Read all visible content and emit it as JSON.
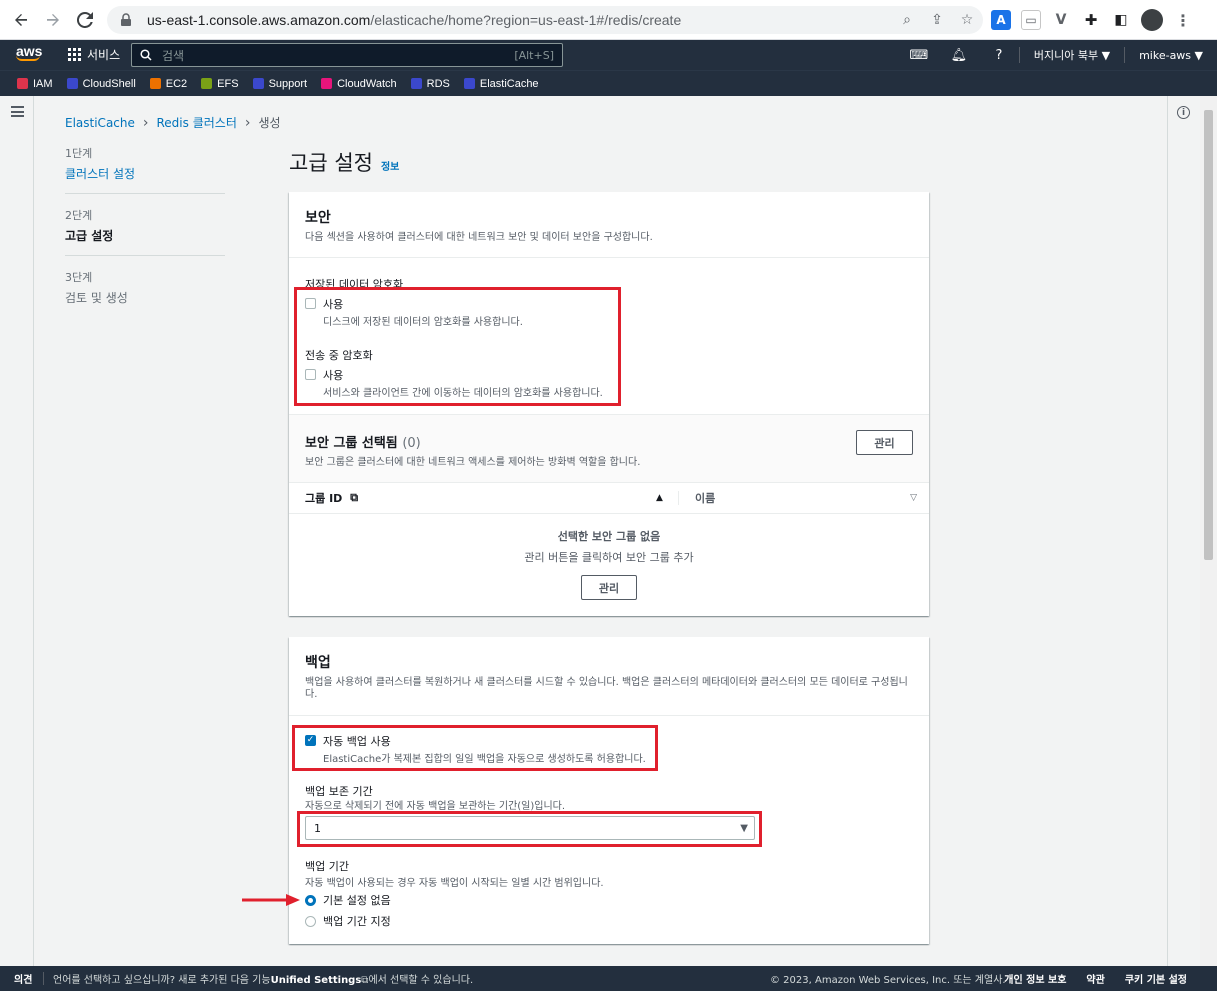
{
  "browser": {
    "url_domain": "us-east-1.console.aws.amazon.com",
    "url_path": "/elasticache/home?region=us-east-1#/redis/create"
  },
  "aws_nav": {
    "logo": "aws",
    "services": "서비스",
    "search_placeholder": "검색",
    "search_shortcut": "[Alt+S]",
    "region": "버지니아 북부 ▼",
    "account": "mike-aws ▼"
  },
  "favorites": [
    {
      "label": "IAM",
      "color": "#dd344c"
    },
    {
      "label": "CloudShell",
      "color": "#3b48cc"
    },
    {
      "label": "EC2",
      "color": "#ed7100"
    },
    {
      "label": "EFS",
      "color": "#7aa116"
    },
    {
      "label": "Support",
      "color": "#3b48cc"
    },
    {
      "label": "CloudWatch",
      "color": "#e7157b"
    },
    {
      "label": "RDS",
      "color": "#3b48cc"
    },
    {
      "label": "ElastiCache",
      "color": "#3b48cc"
    }
  ],
  "breadcrumb": {
    "item1": "ElastiCache",
    "item2": "Redis 클러스터",
    "current": "생성"
  },
  "steps": [
    {
      "num": "1단계",
      "label": "클러스터 설정"
    },
    {
      "num": "2단계",
      "label": "고급 설정"
    },
    {
      "num": "3단계",
      "label": "검토 및 생성"
    }
  ],
  "page": {
    "title": "고급 설정",
    "info": "정보"
  },
  "security": {
    "title": "보안",
    "desc": "다음 섹션을 사용하여 클러스터에 대한 네트워크 보안 및 데이터 보안을 구성합니다.",
    "at_rest_title": "저장된 데이터 암호화",
    "at_rest_label": "사용",
    "at_rest_desc": "디스크에 저장된 데이터의 암호화를 사용합니다.",
    "in_transit_title": "전송 중 암호화",
    "in_transit_label": "사용",
    "in_transit_desc": "서비스와 클라이언트 간에 이동하는 데이터의 암호화를 사용합니다.",
    "sg_title": "보안 그룹 선택됨",
    "sg_count": "(0)",
    "sg_desc": "보안 그룹은 클러스터에 대한 네트워크 액세스를 제어하는 방화벽 역할을 합니다.",
    "manage_label": "관리",
    "col_group_id": "그룹 ID",
    "col_name": "이름",
    "empty_title": "선택한 보안 그룹 없음",
    "empty_desc": "관리 버튼을 클릭하여 보안 그룹 추가",
    "empty_manage": "관리"
  },
  "backup": {
    "title": "백업",
    "desc": "백업을 사용하여 클러스터를 복원하거나 새 클러스터를 시드할 수 있습니다. 백업은 클러스터의 메타데이터와 클러스터의 모든 데이터로 구성됩니다.",
    "auto_label": "자동 백업 사용",
    "auto_desc": "ElastiCache가 복제본 집합의 일일 백업을 자동으로 생성하도록 허용합니다.",
    "auto_checked": true,
    "retention_title": "백업 보존 기간",
    "retention_desc": "자동으로 삭제되기 전에 자동 백업을 보관하는 기간(일)입니다.",
    "retention_value": "1",
    "window_title": "백업 기간",
    "window_desc": "자동 백업이 사용되는 경우 자동 백업이 시작되는 일별 시간 범위입니다.",
    "option_none": "기본 설정 없음",
    "option_specify": "백업 기간 지정"
  },
  "footer": {
    "feedback": "의견",
    "lang_text": "언어를 선택하고 싶으십니까? 새로 추가된 다음 기능",
    "lang_link": "Unified Settings",
    "lang_text2": "에서 선택할 수 있습니다.",
    "copyright": "© 2023, Amazon Web Services, Inc. 또는 계열사.",
    "privacy": "개인 정보 보호",
    "terms": "약관",
    "cookies": "쿠키 기본 설정"
  },
  "colors": {
    "aws_dark": "#232f3e",
    "link": "#0073bb",
    "highlight": "#e0202d"
  }
}
